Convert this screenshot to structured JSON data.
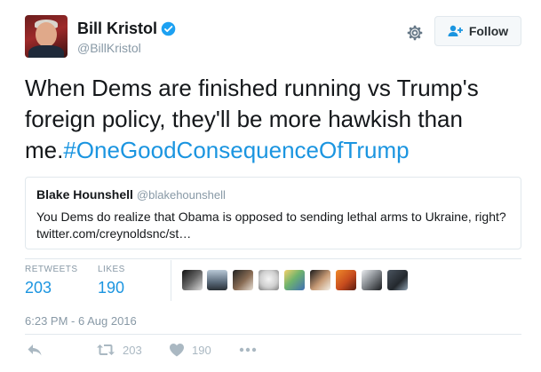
{
  "author": {
    "name": "Bill Kristol",
    "handle": "@BillKristol",
    "verified": true
  },
  "follow_button": {
    "label": "Follow"
  },
  "tweet": {
    "text": "When Dems are finished running vs Trump's foreign policy, they'll be more hawkish than me.",
    "hashtag": "#OneGoodConsequenceOfTrump"
  },
  "quoted_tweet": {
    "name": "Blake Hounshell",
    "handle": "@blakehounshell",
    "text": "You Dems do realize that Obama is opposed to sending lethal arms to Ukraine, right? twitter.com/creynoldsnc/st…"
  },
  "stats": {
    "retweets_label": "RETWEETS",
    "retweets": "203",
    "likes_label": "LIKES",
    "likes": "190"
  },
  "likers_count_shown": 9,
  "timestamp": "6:23 PM - 6 Aug 2016",
  "actions": {
    "reply_icon": "reply-icon",
    "retweet_count": "203",
    "like_count": "190",
    "more_icon": "more-icon"
  },
  "colors": {
    "accent": "#1b95e0",
    "muted": "#8899a6",
    "border": "#e1e8ed",
    "text": "#14171a"
  }
}
